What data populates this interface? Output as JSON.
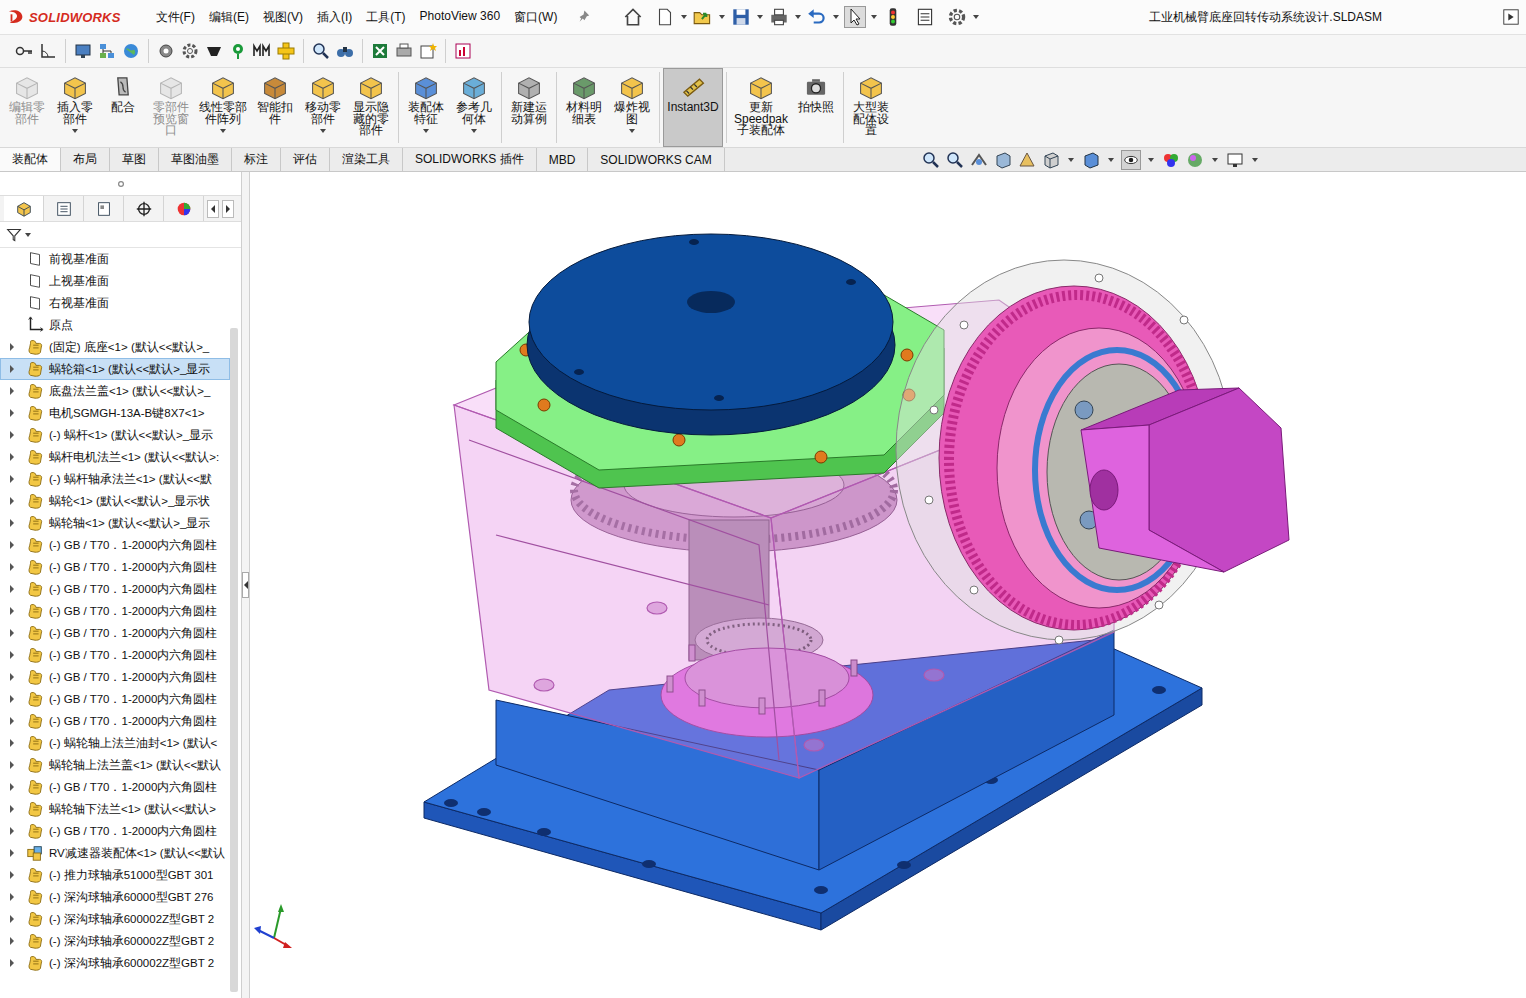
{
  "window": {
    "title": "工业机械臂底座回转传动系统设计.SLDASM",
    "app": "SOLIDWORKS"
  },
  "menus": [
    "文件(F)",
    "编辑(E)",
    "视图(V)",
    "插入(I)",
    "工具(T)",
    "PhotoView 360",
    "窗口(W)"
  ],
  "ribbon": [
    {
      "label": "编辑零\n部件",
      "disabled": true,
      "selected": false,
      "dropdown": false
    },
    {
      "label": "插入零\n部件",
      "disabled": false,
      "selected": false,
      "dropdown": true
    },
    {
      "label": "配合",
      "disabled": false,
      "selected": false,
      "dropdown": false
    },
    {
      "label": "零部件\n预览窗\n口",
      "disabled": true,
      "selected": false,
      "dropdown": false
    },
    {
      "label": "线性零部\n件阵列",
      "disabled": false,
      "selected": false,
      "dropdown": true
    },
    {
      "label": "智能扣\n件",
      "disabled": false,
      "selected": false,
      "dropdown": false
    },
    {
      "label": "移动零\n部件",
      "disabled": false,
      "selected": false,
      "dropdown": true
    },
    {
      "label": "显示隐\n藏的零\n部件",
      "disabled": false,
      "selected": false,
      "dropdown": false
    },
    {
      "label": "装配体\n特征",
      "disabled": false,
      "selected": false,
      "dropdown": true
    },
    {
      "label": "参考几\n何体",
      "disabled": false,
      "selected": false,
      "dropdown": true
    },
    {
      "label": "新建运\n动算例",
      "disabled": false,
      "selected": false,
      "dropdown": false
    },
    {
      "label": "材料明\n细表",
      "disabled": false,
      "selected": false,
      "dropdown": false
    },
    {
      "label": "爆炸视\n图",
      "disabled": false,
      "selected": false,
      "dropdown": true
    },
    {
      "label": "Instant3D",
      "disabled": false,
      "selected": true,
      "dropdown": false
    },
    {
      "label": "更新\nSpeedpak\n子装配体",
      "disabled": false,
      "selected": false,
      "dropdown": false
    },
    {
      "label": "拍快照",
      "disabled": false,
      "selected": false,
      "dropdown": false
    },
    {
      "label": "大型装\n配体设\n置",
      "disabled": false,
      "selected": false,
      "dropdown": false
    }
  ],
  "tabs": [
    {
      "label": "装配体",
      "selected": true
    },
    {
      "label": "布局",
      "selected": false
    },
    {
      "label": "草图",
      "selected": false
    },
    {
      "label": "草图油墨",
      "selected": false
    },
    {
      "label": "标注",
      "selected": false
    },
    {
      "label": "评估",
      "selected": false
    },
    {
      "label": "渲染工具",
      "selected": false
    },
    {
      "label": "SOLIDWORKS 插件",
      "selected": false
    },
    {
      "label": "MBD",
      "selected": false
    },
    {
      "label": "SOLIDWORKS CAM",
      "selected": false
    }
  ],
  "tree": [
    {
      "label": "前视基准面",
      "kind": "plane",
      "selected": false,
      "expanded": false
    },
    {
      "label": "上视基准面",
      "kind": "plane",
      "selected": false,
      "expanded": false
    },
    {
      "label": "右视基准面",
      "kind": "plane",
      "selected": false,
      "expanded": false
    },
    {
      "label": "原点",
      "kind": "origin",
      "selected": false,
      "expanded": false
    },
    {
      "label": "(固定) 底座<1> (默认<<默认>_",
      "kind": "part",
      "selected": false,
      "expanded": false
    },
    {
      "label": "蜗轮箱<1> (默认<<默认>_显示",
      "kind": "part",
      "selected": true,
      "expanded": false
    },
    {
      "label": "底盘法兰盖<1> (默认<<默认>_",
      "kind": "part",
      "selected": false,
      "expanded": false
    },
    {
      "label": "电机SGMGH-13A-B键8X7<1>",
      "kind": "part",
      "selected": false,
      "expanded": false
    },
    {
      "label": "(-) 蜗杆<1> (默认<<默认>_显示",
      "kind": "part",
      "selected": false,
      "expanded": false
    },
    {
      "label": "蜗杆电机法兰<1> (默认<<默认>:",
      "kind": "part",
      "selected": false,
      "expanded": false
    },
    {
      "label": "(-) 蜗杆轴承法兰<1> (默认<<默",
      "kind": "part",
      "selected": false,
      "expanded": false
    },
    {
      "label": "蜗轮<1> (默认<<默认>_显示状",
      "kind": "part",
      "selected": false,
      "expanded": false
    },
    {
      "label": "蜗轮轴<1> (默认<<默认>_显示",
      "kind": "part",
      "selected": false,
      "expanded": false
    },
    {
      "label": "(-) GB / T70．1-2000内六角圆柱",
      "kind": "part",
      "selected": false,
      "expanded": false
    },
    {
      "label": "(-) GB / T70．1-2000内六角圆柱",
      "kind": "part",
      "selected": false,
      "expanded": false
    },
    {
      "label": "(-) GB / T70．1-2000内六角圆柱",
      "kind": "part",
      "selected": false,
      "expanded": false
    },
    {
      "label": "(-) GB / T70．1-2000内六角圆柱",
      "kind": "part",
      "selected": false,
      "expanded": false
    },
    {
      "label": "(-) GB / T70．1-2000内六角圆柱",
      "kind": "part",
      "selected": false,
      "expanded": false
    },
    {
      "label": "(-) GB / T70．1-2000内六角圆柱",
      "kind": "part",
      "selected": false,
      "expanded": false
    },
    {
      "label": "(-) GB / T70．1-2000内六角圆柱",
      "kind": "part",
      "selected": false,
      "expanded": false
    },
    {
      "label": "(-) GB / T70．1-2000内六角圆柱",
      "kind": "part",
      "selected": false,
      "expanded": false
    },
    {
      "label": "(-) GB / T70．1-2000内六角圆柱",
      "kind": "part",
      "selected": false,
      "expanded": false
    },
    {
      "label": "(-) 蜗轮轴上法兰油封<1> (默认<",
      "kind": "part",
      "selected": false,
      "expanded": false
    },
    {
      "label": "蜗轮轴上法兰盖<1> (默认<<默认",
      "kind": "part",
      "selected": false,
      "expanded": false
    },
    {
      "label": "(-) GB / T70．1-2000内六角圆柱",
      "kind": "part",
      "selected": false,
      "expanded": false
    },
    {
      "label": "蜗轮轴下法兰<1> (默认<<默认>",
      "kind": "part",
      "selected": false,
      "expanded": false
    },
    {
      "label": "(-) GB / T70．1-2000内六角圆柱",
      "kind": "part",
      "selected": false,
      "expanded": false
    },
    {
      "label": "RV减速器装配体<1> (默认<<默认",
      "kind": "assembly",
      "selected": false,
      "expanded": false
    },
    {
      "label": "(-) 推力球轴承51000型GBT 301",
      "kind": "part",
      "selected": false,
      "expanded": false
    },
    {
      "label": "(-) 深沟球轴承60000型GBT 276",
      "kind": "part",
      "selected": false,
      "expanded": false
    },
    {
      "label": "(-) 深沟球轴承600002Z型GBT 2",
      "kind": "part",
      "selected": false,
      "expanded": false
    },
    {
      "label": "(-) 深沟球轴承600002Z型GBT 2",
      "kind": "part",
      "selected": false,
      "expanded": false
    },
    {
      "label": "(-) 深沟球轴承600002Z型GBT 2",
      "kind": "part",
      "selected": false,
      "expanded": false
    }
  ]
}
